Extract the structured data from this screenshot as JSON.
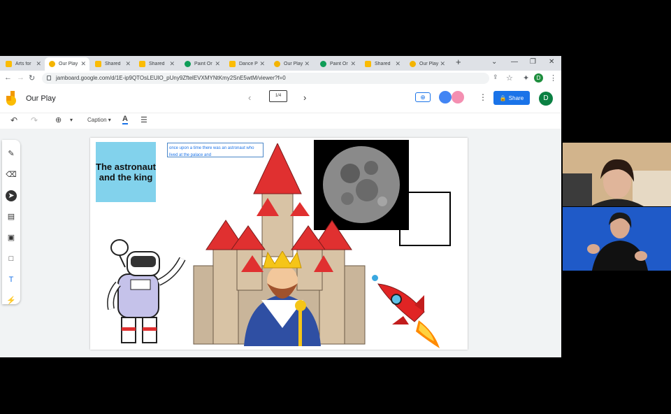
{
  "browser": {
    "tabs": [
      {
        "label": "Arts for",
        "color": "#fbbc04"
      },
      {
        "label": "Our Play",
        "color": "#f4b400",
        "active": true
      },
      {
        "label": "Shared",
        "color": "#fbbc04"
      },
      {
        "label": "Shared",
        "color": "#fbbc04"
      },
      {
        "label": "Paint Or",
        "color": "#0f9d58"
      },
      {
        "label": "Dance P",
        "color": "#fbbc04"
      },
      {
        "label": "Our Play",
        "color": "#f4b400"
      },
      {
        "label": "Paint Or",
        "color": "#0f9d58"
      },
      {
        "label": "Shared",
        "color": "#fbbc04"
      },
      {
        "label": "Our Play",
        "color": "#f4b400"
      }
    ],
    "url": "jamboard.google.com/d/1E-ip9QTOsLEUlO_pUny9ZftelEVXMYNtKmy2SnE5wtM/viewer?f=0",
    "profile_initial": "D"
  },
  "jamboard": {
    "title": "Our Play",
    "frame_indicator": "1/4",
    "share_label": "Share",
    "user_initial": "D",
    "caption_label": "Caption",
    "sticky_note": "The astronaut and the king",
    "text_box": "once upon a time there was an astronaut who lived at the palace and"
  }
}
